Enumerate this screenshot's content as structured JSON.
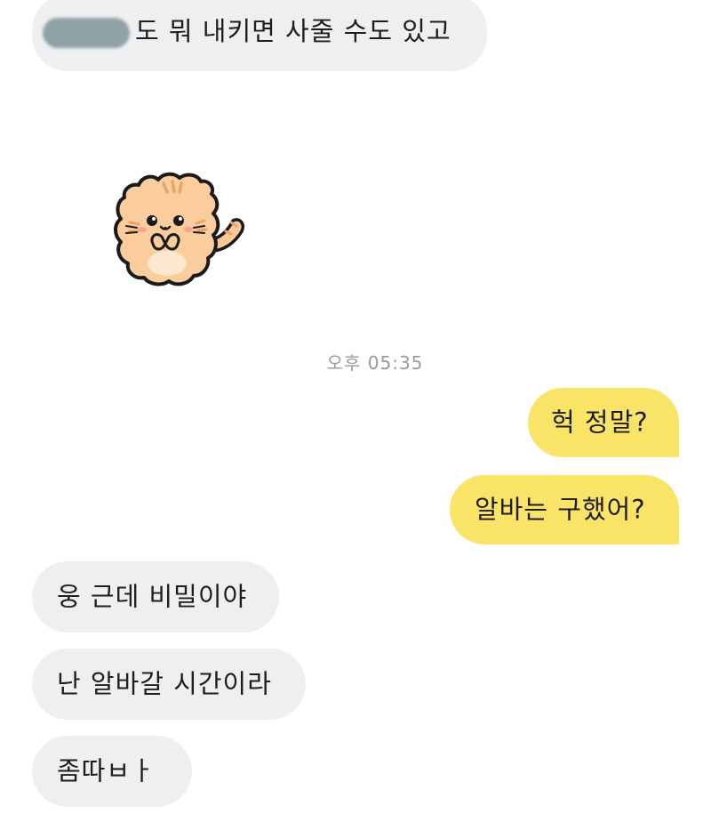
{
  "messages": [
    {
      "side": "in",
      "text": "도 뭐 내키면 사줄 수도 있고",
      "sender_redacted": true
    },
    {
      "side": "in",
      "type": "sticker",
      "sticker": "shy-orange-cat-sticker"
    },
    {
      "side": "out",
      "text": "헉 정말?"
    },
    {
      "side": "out",
      "text": "알바는 구했어?"
    },
    {
      "side": "in",
      "text": "웅 근데 비밀이야"
    },
    {
      "side": "in",
      "text": "난 알바갈 시간이라"
    },
    {
      "side": "in",
      "text": "좀따ㅂㅏ"
    }
  ],
  "timestamp": "오후 05:35",
  "colors": {
    "incoming_bubble": "#eeeff1",
    "outgoing_bubble": "#fae468",
    "background": "#ffffff",
    "text": "#1e1e1e",
    "timestamp": "#9a9a9a"
  }
}
